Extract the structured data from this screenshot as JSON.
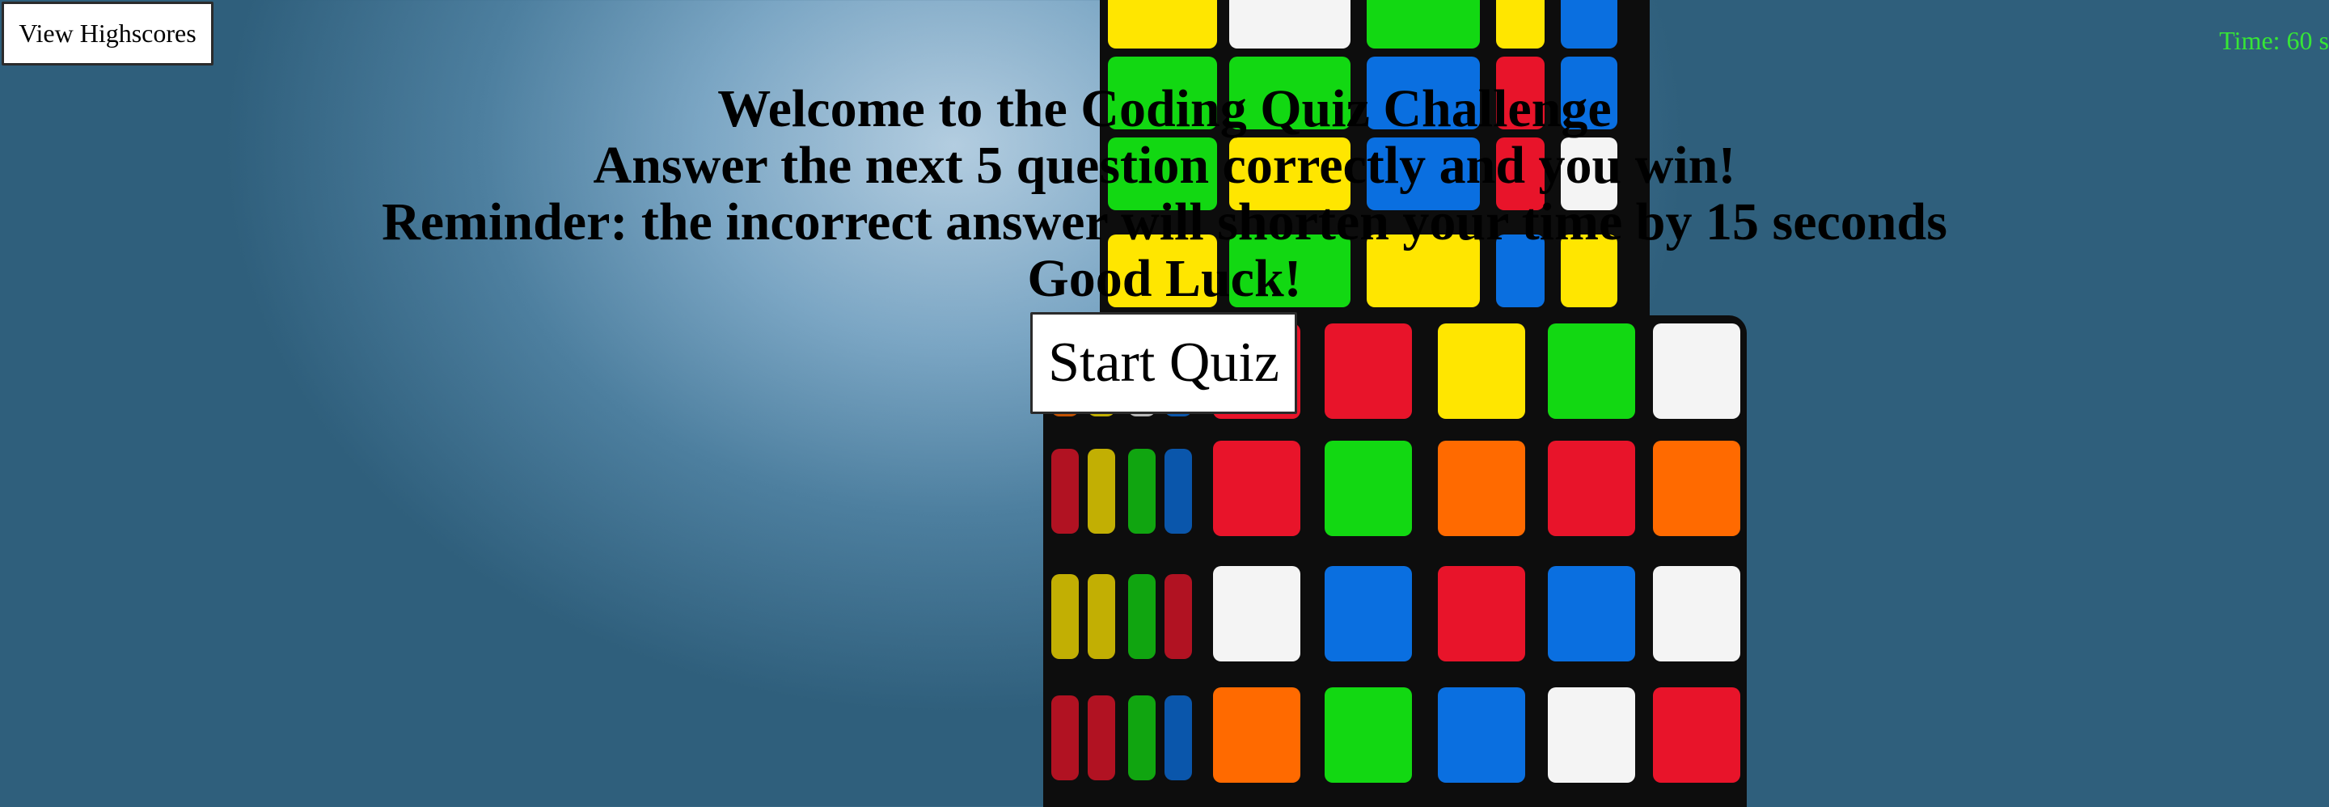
{
  "header": {
    "view_highscores_label": "View Highscores",
    "timer_text": "Time: 60 s"
  },
  "intro": {
    "lines": [
      "Welcome to the Coding Quiz Challenge",
      "Answer the next 5 question correctly and you win!",
      "Reminder: the incorrect answer will shorten your time by 15 seconds",
      "Good Luck!"
    ],
    "start_label": "Start Quiz"
  },
  "colors": {
    "timer": "#36e636",
    "background_center": "#b3cde0",
    "background_edge": "#2f5f7c",
    "tile_red": "#e8142a",
    "tile_green": "#12d812",
    "tile_orange": "#ff6a00",
    "tile_blue": "#0a6fe0",
    "tile_white": "#f4f4f4",
    "tile_yellow": "#ffe600"
  }
}
